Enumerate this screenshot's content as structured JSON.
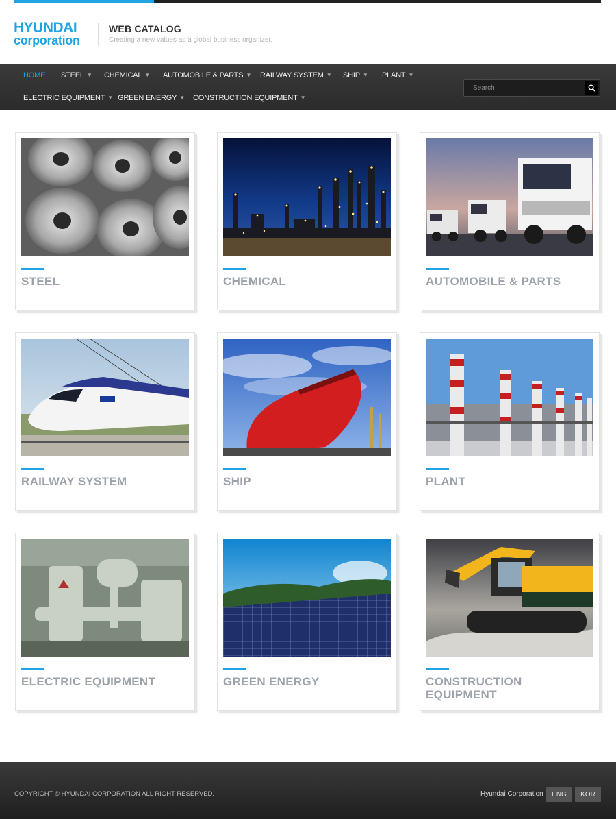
{
  "brand": {
    "logo_line1": "HYUNDAI",
    "logo_line2": "corporation",
    "catalog_title": "WEB CATALOG",
    "tagline": "Creating a new values as a global business organizer.",
    "accent_color": "#1fa3e3"
  },
  "nav": {
    "items": [
      {
        "label": "HOME",
        "active": true,
        "has_caret": false
      },
      {
        "label": "STEEL",
        "has_caret": true
      },
      {
        "label": "CHEMICAL",
        "has_caret": true
      },
      {
        "label": "AUTOMOBILE & PARTS",
        "has_caret": true
      },
      {
        "label": "RAILWAY SYSTEM",
        "has_caret": true
      },
      {
        "label": "SHIP",
        "has_caret": true
      },
      {
        "label": "PLANT",
        "has_caret": true
      },
      {
        "label": "ELECTRIC EQUIPMENT",
        "has_caret": true
      },
      {
        "label": "GREEN ENERGY",
        "has_caret": true
      },
      {
        "label": "CONSTRUCTION EQUIPMENT",
        "has_caret": true
      }
    ],
    "caret_icon": "chevron-down-icon",
    "search_placeholder": "Search",
    "search_icon": "search-icon"
  },
  "catalog": {
    "cards": [
      {
        "title": "STEEL",
        "image": "steel-coils-image"
      },
      {
        "title": "CHEMICAL",
        "image": "chemical-plant-night-image"
      },
      {
        "title": "AUTOMOBILE & PARTS",
        "image": "trucks-image"
      },
      {
        "title": "RAILWAY SYSTEM",
        "image": "ktx-train-image"
      },
      {
        "title": "SHIP",
        "image": "red-ship-image"
      },
      {
        "title": "PLANT",
        "image": "power-plant-image"
      },
      {
        "title": "ELECTRIC EQUIPMENT",
        "image": "transformer-image"
      },
      {
        "title": "GREEN ENERGY",
        "image": "solar-panels-image"
      },
      {
        "title": "CONSTRUCTION EQUIPMENT",
        "image": "excavator-image"
      }
    ]
  },
  "footer": {
    "copyright": "COPYRIGHT © HYUNDAI CORPORATION ALL RIGHT RESERVED.",
    "company": "Hyundai Corporation",
    "lang_eng": "ENG",
    "lang_kor": "KOR"
  }
}
